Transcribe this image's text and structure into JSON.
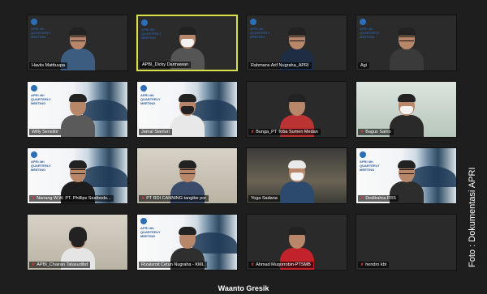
{
  "participants": [
    {
      "name": "Haviis Matttuupa",
      "mic_muted": false,
      "bg": "apri",
      "mask": "",
      "glasses": true,
      "active": false
    },
    {
      "name": "APBI_Dicky Darmawan",
      "mic_muted": false,
      "bg": "apri",
      "mask": "white",
      "glasses": false,
      "active": true
    },
    {
      "name": "Rahmans Arif Nugraha_APRI",
      "mic_muted": false,
      "bg": "apri",
      "mask": "",
      "glasses": true,
      "active": false
    },
    {
      "name": "Agi",
      "mic_muted": false,
      "bg": "apri",
      "mask": "",
      "glasses": true,
      "active": false
    },
    {
      "name": "Willy Sensilor",
      "mic_muted": false,
      "bg": "apri",
      "mask": "",
      "glasses": false,
      "active": false
    },
    {
      "name": "Jamal Sianturi",
      "mic_muted": false,
      "bg": "apri",
      "mask": "dark",
      "glasses": false,
      "active": false
    },
    {
      "name": "Bunga_PT Toba Sumen Medan",
      "mic_muted": true,
      "bg": "wall",
      "mask": "",
      "glasses": false,
      "active": false
    },
    {
      "name": "Bagus Satrio",
      "mic_muted": true,
      "bg": "mint",
      "mask": "white",
      "glasses": false,
      "active": false
    },
    {
      "name": "Nanang W.W. PT. Phillips Seafoods...",
      "mic_muted": true,
      "bg": "apri",
      "mask": "",
      "glasses": true,
      "active": false
    },
    {
      "name": "PT RDI CANNING tangibe por",
      "mic_muted": true,
      "bg": "room",
      "mask": "",
      "glasses": true,
      "active": false
    },
    {
      "name": "Yoga Sadana",
      "mic_muted": false,
      "bg": "car",
      "mask": "white",
      "glasses": false,
      "active": false
    },
    {
      "name": "Dedikahra FRS",
      "mic_muted": true,
      "bg": "apri",
      "mask": "",
      "glasses": true,
      "active": false
    },
    {
      "name": "APBI_Chairan Tatasudibd",
      "mic_muted": true,
      "bg": "room",
      "mask": "dark",
      "glasses": false,
      "active": false
    },
    {
      "name": "Rizalsroit Cetun Nugraha - KML",
      "mic_muted": false,
      "bg": "apri",
      "mask": "",
      "glasses": false,
      "active": false
    },
    {
      "name": "Ahmad Muqorrobin-PTSMB",
      "mic_muted": true,
      "bg": "dark",
      "mask": "",
      "glasses": false,
      "active": false
    },
    {
      "name": "hendro kbt",
      "mic_muted": true,
      "bg": "dark",
      "mask": "",
      "glasses": false,
      "active": false
    }
  ],
  "meeting_banner": "APRI 4th QUARTERLY MEETING",
  "speaker_label": "Waanto Gresik",
  "photo_credit": "Foto : Dokumentasi APRI",
  "colors": {
    "active_border": "#d8e04a",
    "mic_muted": "#e23b3b",
    "apri_blue": "#2d6fb6"
  }
}
